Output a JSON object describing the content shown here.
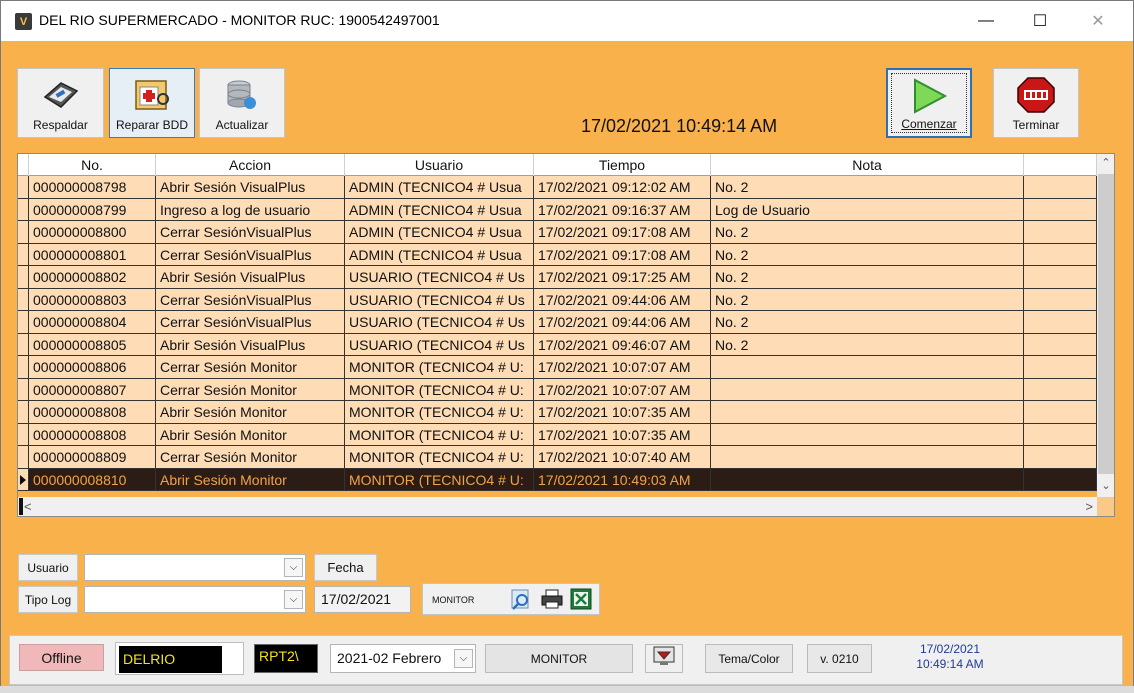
{
  "window": {
    "title": "DEL RIO SUPERMERCADO - MONITOR RUC: 1900542497001",
    "icon_text": "V",
    "min_glyph": "—",
    "max_glyph": "☐",
    "close_glyph": "✕"
  },
  "toolbar": {
    "respaldar": "Respaldar",
    "reparar": "Reparar BDD",
    "actualizar": "Actualizar",
    "comenzar": "Comenzar",
    "terminar": "Terminar"
  },
  "datetime": "17/02/2021 10:49:14 AM",
  "grid": {
    "columns": [
      "No.",
      "Accion",
      "Usuario",
      "Tiempo",
      "Nota"
    ],
    "rows": [
      {
        "no": "000000008798",
        "accion": "Abrir Sesión VisualPlus",
        "usuario": "ADMIN (TECNICO4 # Usua",
        "tiempo": "17/02/2021 09:12:02 AM",
        "nota": "No. 2"
      },
      {
        "no": "000000008799",
        "accion": "Ingreso a log de usuario",
        "usuario": "ADMIN (TECNICO4 # Usua",
        "tiempo": "17/02/2021 09:16:37 AM",
        "nota": "Log de Usuario"
      },
      {
        "no": "000000008800",
        "accion": "Cerrar SesiónVisualPlus",
        "usuario": "ADMIN (TECNICO4 # Usua",
        "tiempo": "17/02/2021 09:17:08 AM",
        "nota": "No. 2"
      },
      {
        "no": "000000008801",
        "accion": "Cerrar SesiónVisualPlus",
        "usuario": "ADMIN (TECNICO4 # Usua",
        "tiempo": "17/02/2021 09:17:08 AM",
        "nota": "No. 2"
      },
      {
        "no": "000000008802",
        "accion": "Abrir Sesión VisualPlus",
        "usuario": "USUARIO (TECNICO4 # Us",
        "tiempo": "17/02/2021 09:17:25 AM",
        "nota": "No. 2"
      },
      {
        "no": "000000008803",
        "accion": "Cerrar SesiónVisualPlus",
        "usuario": "USUARIO (TECNICO4 # Us",
        "tiempo": "17/02/2021 09:44:06 AM",
        "nota": "No. 2"
      },
      {
        "no": "000000008804",
        "accion": "Cerrar SesiónVisualPlus",
        "usuario": "USUARIO (TECNICO4 # Us",
        "tiempo": "17/02/2021 09:44:06 AM",
        "nota": "No. 2"
      },
      {
        "no": "000000008805",
        "accion": "Abrir Sesión VisualPlus",
        "usuario": "USUARIO (TECNICO4 # Us",
        "tiempo": "17/02/2021 09:46:07 AM",
        "nota": "No. 2"
      },
      {
        "no": "000000008806",
        "accion": "Cerrar Sesión Monitor",
        "usuario": "MONITOR (TECNICO4 # U:",
        "tiempo": "17/02/2021 10:07:07 AM",
        "nota": ""
      },
      {
        "no": "000000008807",
        "accion": "Cerrar Sesión Monitor",
        "usuario": "MONITOR (TECNICO4 # U:",
        "tiempo": "17/02/2021 10:07:07 AM",
        "nota": ""
      },
      {
        "no": "000000008808",
        "accion": "Abrir Sesión Monitor",
        "usuario": "MONITOR (TECNICO4 # U:",
        "tiempo": "17/02/2021 10:07:35 AM",
        "nota": ""
      },
      {
        "no": "000000008808",
        "accion": "Abrir Sesión Monitor",
        "usuario": "MONITOR (TECNICO4 # U:",
        "tiempo": "17/02/2021 10:07:35 AM",
        "nota": ""
      },
      {
        "no": "000000008809",
        "accion": "Cerrar Sesión Monitor",
        "usuario": "MONITOR (TECNICO4 # U:",
        "tiempo": "17/02/2021 10:07:40 AM",
        "nota": ""
      },
      {
        "no": "000000008810",
        "accion": "Abrir Sesión Monitor",
        "usuario": "MONITOR (TECNICO4 # U:",
        "tiempo": "17/02/2021 10:49:03 AM",
        "nota": "",
        "selected": true
      }
    ],
    "scroll_up": "⌃",
    "scroll_down": "⌄",
    "scroll_left": "<",
    "scroll_right": ">"
  },
  "filters": {
    "usuario_label": "Usuario",
    "usuario_value": "",
    "tipolog_label": "Tipo Log",
    "tipolog_value": "",
    "fecha_label": "Fecha",
    "fecha_value": "17/02/2021",
    "monitor_label": "MONITOR",
    "combo_arrow": "⌵"
  },
  "statusbar": {
    "offline": "Offline",
    "database": "DELRIO",
    "report_path": "RPT2\\",
    "period": "2021-02  Febrero",
    "monitor": "MONITOR",
    "tema": "Tema/Color",
    "version": "v. 0210",
    "clock_date": "17/02/2021",
    "clock_time": "10:49:14 AM"
  },
  "icons": {
    "respaldar": "backup-disk-icon",
    "reparar": "repair-db-icon",
    "actualizar": "update-db-icon",
    "comenzar": "play-icon",
    "terminar": "stop-sign-icon",
    "search": "search-icon",
    "print": "printer-icon",
    "excel": "excel-icon",
    "screen": "screen-icon"
  },
  "colors": {
    "background": "#f9b14c",
    "grid_row": "#fddcb6",
    "selected_row": "#2b1d16",
    "selected_text": "#f3a347",
    "status_text": "#f5e317"
  }
}
